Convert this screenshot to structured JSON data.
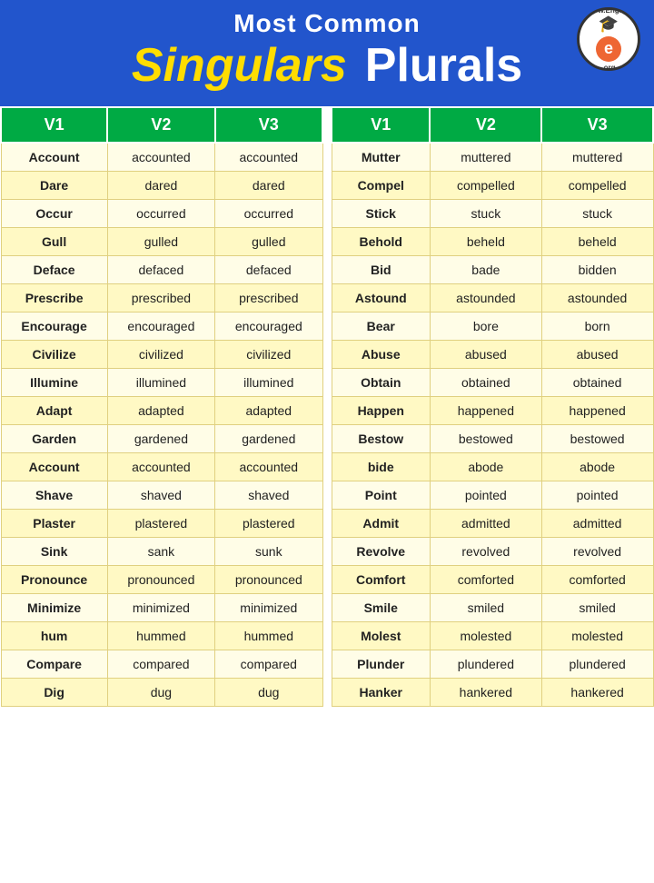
{
  "header": {
    "most_common": "Most Common",
    "singulars": "Singulars",
    "plurals": "Plurals"
  },
  "logo": {
    "top_text": "www.EngDic",
    "bottom_text": ".org",
    "letter": "e"
  },
  "left_table": {
    "columns": [
      "V1",
      "V2",
      "V3"
    ],
    "rows": [
      [
        "Account",
        "accounted",
        "accounted"
      ],
      [
        "Dare",
        "dared",
        "dared"
      ],
      [
        "Occur",
        "occurred",
        "occurred"
      ],
      [
        "Gull",
        "gulled",
        "gulled"
      ],
      [
        "Deface",
        "defaced",
        "defaced"
      ],
      [
        "Prescribe",
        "prescribed",
        "prescribed"
      ],
      [
        "Encourage",
        "encouraged",
        "encouraged"
      ],
      [
        "Civilize",
        "civilized",
        "civilized"
      ],
      [
        "Illumine",
        "illumined",
        "illumined"
      ],
      [
        "Adapt",
        "adapted",
        "adapted"
      ],
      [
        "Garden",
        "gardened",
        "gardened"
      ],
      [
        "Account",
        "accounted",
        "accounted"
      ],
      [
        "Shave",
        "shaved",
        "shaved"
      ],
      [
        "Plaster",
        "plastered",
        "plastered"
      ],
      [
        "Sink",
        "sank",
        "sunk"
      ],
      [
        "Pronounce",
        "pronounced",
        "pronounced"
      ],
      [
        "Minimize",
        "minimized",
        "minimized"
      ],
      [
        "hum",
        "hummed",
        "hummed"
      ],
      [
        "Compare",
        "compared",
        "compared"
      ],
      [
        "Dig",
        "dug",
        "dug"
      ]
    ]
  },
  "right_table": {
    "columns": [
      "V1",
      "V2",
      "V3"
    ],
    "rows": [
      [
        "Mutter",
        "muttered",
        "muttered"
      ],
      [
        "Compel",
        "compelled",
        "compelled"
      ],
      [
        "Stick",
        "stuck",
        "stuck"
      ],
      [
        "Behold",
        "beheld",
        "beheld"
      ],
      [
        "Bid",
        "bade",
        "bidden"
      ],
      [
        "Astound",
        "astounded",
        "astounded"
      ],
      [
        "Bear",
        "bore",
        "born"
      ],
      [
        "Abuse",
        "abused",
        "abused"
      ],
      [
        "Obtain",
        "obtained",
        "obtained"
      ],
      [
        "Happen",
        "happened",
        "happened"
      ],
      [
        "Bestow",
        "bestowed",
        "bestowed"
      ],
      [
        "bide",
        "abode",
        "abode"
      ],
      [
        "Point",
        "pointed",
        "pointed"
      ],
      [
        "Admit",
        "admitted",
        "admitted"
      ],
      [
        "Revolve",
        "revolved",
        "revolved"
      ],
      [
        "Comfort",
        "comforted",
        "comforted"
      ],
      [
        "Smile",
        "smiled",
        "smiled"
      ],
      [
        "Molest",
        "molested",
        "molested"
      ],
      [
        "Plunder",
        "plundered",
        "plundered"
      ],
      [
        "Hanker",
        "hankered",
        "hankered"
      ]
    ]
  }
}
